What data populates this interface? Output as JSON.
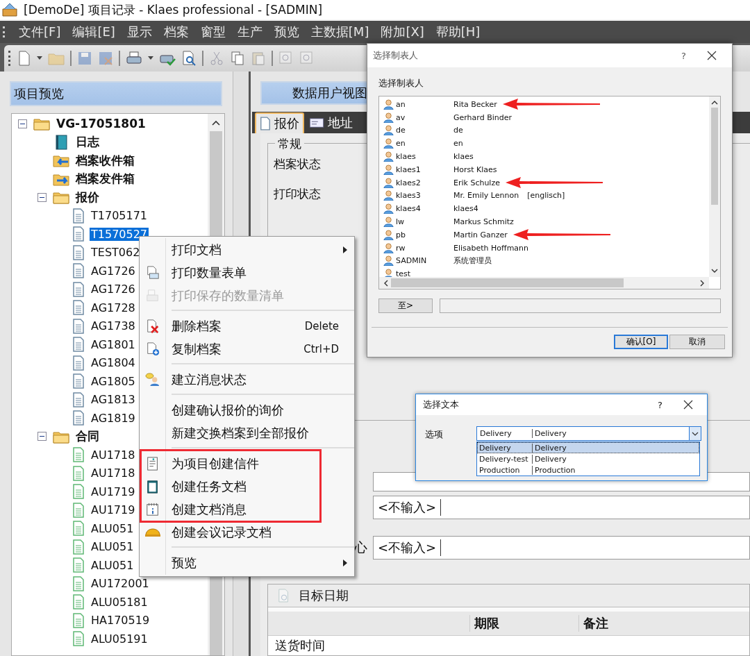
{
  "window": {
    "title": "[DemoDe] 项目记录 - Klaes professional - [SADMIN]"
  },
  "menu_bar": [
    "文件[F]",
    "编辑[E]",
    "显示",
    "档案",
    "窗型",
    "生产",
    "预览",
    "主数据[M]",
    "附加[X]",
    "帮助[H]"
  ],
  "project_panel": {
    "title": "项目预览",
    "tree": [
      {
        "label": "VG-17051801",
        "kind": "folder",
        "selected": false,
        "expanded": true,
        "children": [
          {
            "label": "日志",
            "kind": "log",
            "selected": false
          },
          {
            "label": "档案收件箱",
            "kind": "inbox",
            "selected": false
          },
          {
            "label": "档案发件箱",
            "kind": "outbox",
            "selected": false
          },
          {
            "label": "报价",
            "kind": "folder",
            "selected": false,
            "expanded": true,
            "children": [
              {
                "label": "T1705171",
                "kind": "quote-document",
                "selected": false
              },
              {
                "label": "T1570527",
                "kind": "quote-document",
                "selected": true
              },
              {
                "label": "TEST062",
                "kind": "quote-document",
                "selected": false
              },
              {
                "label": "AG1726",
                "kind": "quote-document",
                "selected": false
              },
              {
                "label": "AG1726",
                "kind": "quote-document",
                "selected": false
              },
              {
                "label": "AG1728",
                "kind": "quote-document",
                "selected": false
              },
              {
                "label": "AG1738",
                "kind": "quote-document",
                "selected": false
              },
              {
                "label": "AG1801",
                "kind": "quote-document",
                "selected": false
              },
              {
                "label": "AG1804",
                "kind": "quote-document",
                "selected": false
              },
              {
                "label": "AG1805",
                "kind": "quote-document",
                "selected": false
              },
              {
                "label": "AG1813",
                "kind": "quote-document",
                "selected": false
              },
              {
                "label": "AG1819",
                "kind": "quote-document",
                "selected": false
              }
            ]
          },
          {
            "label": "合同",
            "kind": "folder",
            "selected": false,
            "expanded": true,
            "children": [
              {
                "label": "AU1718",
                "kind": "contract-document",
                "selected": false
              },
              {
                "label": "AU1718",
                "kind": "contract-document",
                "selected": false
              },
              {
                "label": "AU1719",
                "kind": "contract-document",
                "selected": false
              },
              {
                "label": "AU1719",
                "kind": "contract-document",
                "selected": false
              },
              {
                "label": "ALU051",
                "kind": "contract-document",
                "selected": false
              },
              {
                "label": "ALU051",
                "kind": "contract-document",
                "selected": false
              },
              {
                "label": "ALU051",
                "kind": "contract-document",
                "selected": false
              },
              {
                "label": "AU172001",
                "kind": "contract-document",
                "selected": false
              },
              {
                "label": "ALU05181",
                "kind": "contract-document",
                "selected": false
              },
              {
                "label": "HA170519",
                "kind": "contract-document",
                "selected": false
              },
              {
                "label": "ALU05191",
                "kind": "contract-document",
                "selected": false
              }
            ]
          }
        ]
      }
    ]
  },
  "data_view": {
    "title": "数据用户视图",
    "tabs": [
      {
        "label": "报价",
        "selected": true
      },
      {
        "label": "地址",
        "selected": false
      }
    ],
    "group": {
      "title": "常规",
      "fields": [
        "档案状态",
        "打印状态"
      ]
    },
    "inputs": [
      {
        "value": "<不输入>"
      },
      {
        "label": "心",
        "value": "<不输入>"
      }
    ],
    "target_dates": {
      "title": "目标日期",
      "columns": [
        "期限",
        "备注"
      ],
      "rows": [
        "送货时间"
      ]
    }
  },
  "context_menu": {
    "sections": [
      {
        "items": [
          {
            "label": "打印文档",
            "submenu": true,
            "disabled": false,
            "highlighted": false
          },
          {
            "label": "打印数量表单",
            "submenu": false,
            "disabled": false,
            "highlighted": false
          },
          {
            "label": "打印保存的数量清单",
            "submenu": false,
            "disabled": true,
            "highlighted": false
          }
        ]
      },
      {
        "items": [
          {
            "label": "删除档案",
            "shortcut": "Delete",
            "submenu": false,
            "disabled": false,
            "highlighted": false
          },
          {
            "label": "复制档案",
            "shortcut": "Ctrl+D",
            "submenu": false,
            "disabled": false,
            "highlighted": false
          }
        ]
      },
      {
        "items": [
          {
            "label": "建立消息状态",
            "submenu": false,
            "disabled": false,
            "highlighted": false
          }
        ]
      },
      {
        "items": [
          {
            "label": "创建确认报价的询价",
            "submenu": false,
            "disabled": false,
            "highlighted": false
          },
          {
            "label": "新建交换档案到全部报价",
            "submenu": false,
            "disabled": false,
            "highlighted": false
          }
        ]
      },
      {
        "items": [
          {
            "label": "为项目创建信件",
            "submenu": false,
            "disabled": false,
            "highlighted": true
          },
          {
            "label": "创建任务文档",
            "submenu": false,
            "disabled": false,
            "highlighted": true
          },
          {
            "label": "创建文档消息",
            "submenu": false,
            "disabled": false,
            "highlighted": true
          },
          {
            "label": "创建会议记录文档",
            "submenu": false,
            "disabled": false,
            "highlighted": false
          }
        ]
      },
      {
        "items": [
          {
            "label": "预览",
            "submenu": true,
            "disabled": false,
            "highlighted": false
          }
        ]
      }
    ]
  },
  "user_dialog": {
    "title": "选择制表人",
    "help": "?",
    "prompt": "选择制表人",
    "users": [
      {
        "login": "an",
        "name": "Rita Becker",
        "marked": true
      },
      {
        "login": "av",
        "name": "Gerhard Binder",
        "marked": false
      },
      {
        "login": "de",
        "name": "de",
        "marked": false
      },
      {
        "login": "en",
        "name": "en",
        "marked": false
      },
      {
        "login": "klaes",
        "name": "klaes",
        "marked": false
      },
      {
        "login": "klaes1",
        "name": "Horst Klaes",
        "marked": false
      },
      {
        "login": "klaes2",
        "name": "Erik Schulze",
        "marked": true
      },
      {
        "login": "klaes3",
        "name": "Mr. Emily Lennon",
        "language": "[englisch]",
        "marked": false
      },
      {
        "login": "klaes4",
        "name": "klaes4",
        "marked": false
      },
      {
        "login": "lw",
        "name": "Markus Schmitz",
        "marked": false
      },
      {
        "login": "pb",
        "name": "Martin Ganzer",
        "marked": true
      },
      {
        "login": "rw",
        "name": "Elisabeth Hoffmann",
        "marked": false
      },
      {
        "login": "SADMIN",
        "name": "系统管理员",
        "marked": false
      },
      {
        "login": "test",
        "marked": false
      }
    ],
    "goto_button": "至>",
    "buttons": [
      {
        "label": "确认[O]",
        "default": true
      },
      {
        "label": "取消",
        "default": false
      }
    ]
  },
  "text_dialog": {
    "title": "选择文本",
    "help": "?",
    "label": "选项",
    "combo": {
      "code": "Delivery",
      "text": "Delivery"
    },
    "options": [
      {
        "code": "Delivery",
        "text": "Delivery",
        "selected": true
      },
      {
        "code": "Delivery-test",
        "text": "Delivery",
        "selected": false
      },
      {
        "code": "Production",
        "text": "Production",
        "selected": false
      }
    ]
  }
}
